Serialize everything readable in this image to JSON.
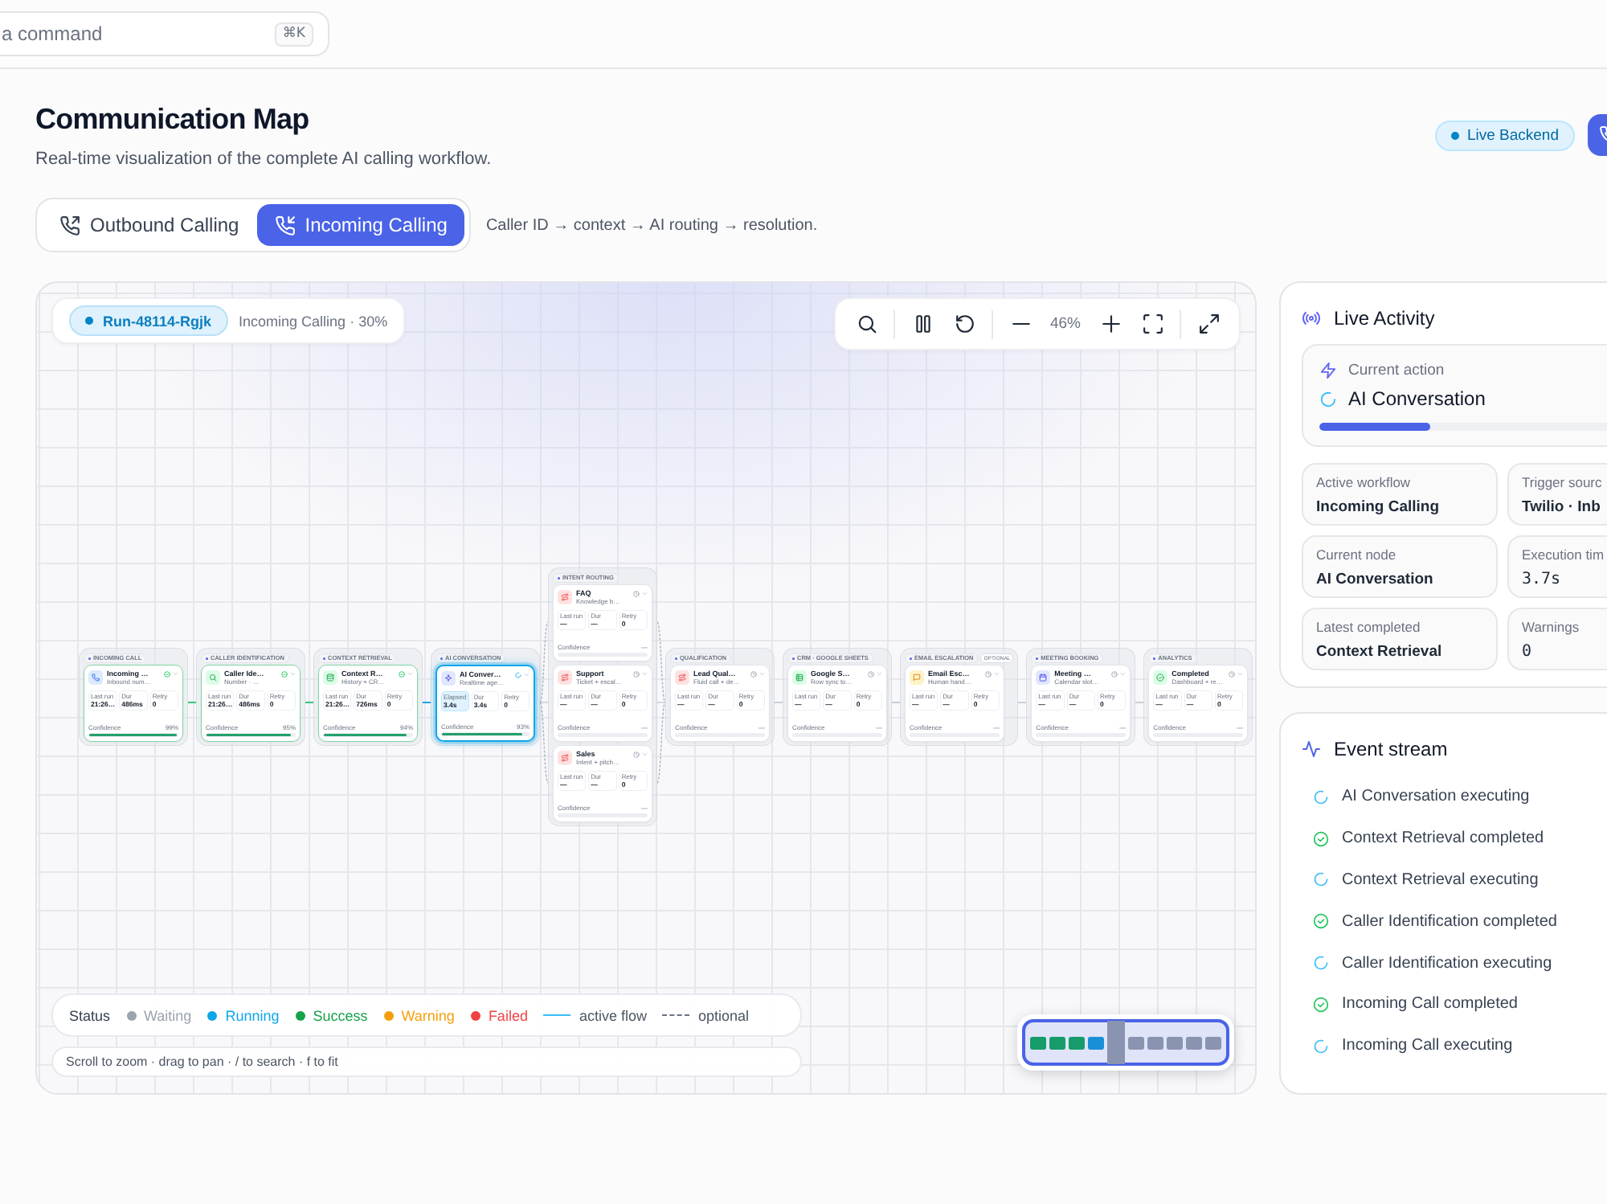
{
  "command_search": {
    "placeholder": "a command",
    "shortcut": "⌘K"
  },
  "header": {
    "title": "Communication Map",
    "subtitle": "Real-time visualization of the complete AI calling workflow.",
    "status": "Live Backend"
  },
  "tabs": [
    {
      "label": "Outbound Calling",
      "kind": "outgoing",
      "selected": false
    },
    {
      "label": "Incoming Calling",
      "kind": "incoming",
      "selected": true
    }
  ],
  "flow_description": "Caller ID → context → AI routing → resolution.",
  "canvas": {
    "run": {
      "id": "Run-48114-Rgjk",
      "summary": "Incoming Calling · 30%"
    },
    "zoom": "46%",
    "groups": [
      {
        "label": "INCOMING CALL",
        "nodes": [
          {
            "title": "Incoming …",
            "subtitle": "Inbound num…",
            "kind": "phone",
            "completed": true,
            "running": false,
            "stats": [
              {
                "label": "Last run",
                "value": "21:26…"
              },
              {
                "label": "Dur",
                "value": "486ms"
              },
              {
                "label": "Retry",
                "value": "0"
              }
            ],
            "confidence": {
              "label": "Confidence",
              "value": "99%",
              "level": 0.99
            }
          }
        ]
      },
      {
        "label": "CALLER IDENTIFICATION",
        "nodes": [
          {
            "title": "Caller Ide…",
            "subtitle": "Number · …",
            "kind": "search",
            "completed": true,
            "running": false,
            "stats": [
              {
                "label": "Last run",
                "value": "21:26…"
              },
              {
                "label": "Dur",
                "value": "486ms"
              },
              {
                "label": "Retry",
                "value": "0"
              }
            ],
            "confidence": {
              "label": "Confidence",
              "value": "95%",
              "level": 0.95
            }
          }
        ]
      },
      {
        "label": "CONTEXT RETRIEVAL",
        "nodes": [
          {
            "title": "Context R…",
            "subtitle": "History + CR…",
            "kind": "database",
            "completed": true,
            "running": false,
            "stats": [
              {
                "label": "Last run",
                "value": "21:26…"
              },
              {
                "label": "Dur",
                "value": "726ms"
              },
              {
                "label": "Retry",
                "value": "0"
              }
            ],
            "confidence": {
              "label": "Confidence",
              "value": "94%",
              "level": 0.94
            }
          }
        ]
      },
      {
        "label": "AI CONVERSATION",
        "nodes": [
          {
            "title": "AI Conver…",
            "subtitle": "Realtime age…",
            "kind": "ai",
            "completed": false,
            "running": true,
            "stats": [
              {
                "label": "Elapsed",
                "value": "3.4s"
              },
              {
                "label": "Dur",
                "value": "3.4s"
              },
              {
                "label": "Retry",
                "value": "0"
              }
            ],
            "confidence": {
              "label": "Confidence",
              "value": "93%",
              "level": 0.93
            }
          }
        ]
      },
      {
        "label": "INTENT ROUTING",
        "nodes": [
          {
            "title": "FAQ",
            "subtitle": "Knowledge b…",
            "kind": "route",
            "completed": false,
            "running": false,
            "stats": [
              {
                "label": "Last run",
                "value": "—"
              },
              {
                "label": "Dur",
                "value": "—"
              },
              {
                "label": "Retry",
                "value": "0"
              }
            ],
            "confidence": {
              "label": "Confidence",
              "value": "—"
            }
          },
          {
            "title": "Support",
            "subtitle": "Ticket + escal…",
            "kind": "route",
            "completed": false,
            "running": false,
            "stats": [
              {
                "label": "Last run",
                "value": "—"
              },
              {
                "label": "Dur",
                "value": "—"
              },
              {
                "label": "Retry",
                "value": "0"
              }
            ],
            "confidence": {
              "label": "Confidence",
              "value": "—"
            }
          },
          {
            "title": "Sales",
            "subtitle": "Intent + pitch…",
            "kind": "route",
            "completed": false,
            "running": false,
            "stats": [
              {
                "label": "Last run",
                "value": "—"
              },
              {
                "label": "Dur",
                "value": "—"
              },
              {
                "label": "Retry",
                "value": "0"
              }
            ],
            "confidence": {
              "label": "Confidence",
              "value": "—"
            }
          }
        ]
      },
      {
        "label": "QUALIFICATION",
        "nodes": [
          {
            "title": "Lead Qual…",
            "subtitle": "Fluid call + de…",
            "kind": "route",
            "completed": false,
            "running": false,
            "stats": [
              {
                "label": "Last run",
                "value": "—"
              },
              {
                "label": "Dur",
                "value": "—"
              },
              {
                "label": "Retry",
                "value": "0"
              }
            ],
            "confidence": {
              "label": "Confidence",
              "value": "—"
            }
          }
        ]
      },
      {
        "label": "CRM · GOOGLE SHEETS",
        "nodes": [
          {
            "title": "Google S…",
            "subtitle": "Row sync to…",
            "kind": "sheet",
            "completed": false,
            "running": false,
            "stats": [
              {
                "label": "Last run",
                "value": "—"
              },
              {
                "label": "Dur",
                "value": "—"
              },
              {
                "label": "Retry",
                "value": "0"
              }
            ],
            "confidence": {
              "label": "Confidence",
              "value": "—"
            }
          }
        ]
      },
      {
        "label": "EMAIL ESCALATION",
        "badge": "OPTIONAL",
        "nodes": [
          {
            "title": "Email Esc…",
            "subtitle": "Human hand…",
            "kind": "mail",
            "completed": false,
            "running": false,
            "stats": [
              {
                "label": "Last run",
                "value": "—"
              },
              {
                "label": "Dur",
                "value": "—"
              },
              {
                "label": "Retry",
                "value": "0"
              }
            ],
            "confidence": {
              "label": "Confidence",
              "value": "—"
            }
          }
        ]
      },
      {
        "label": "MEETING BOOKING",
        "nodes": [
          {
            "title": "Meeting …",
            "subtitle": "Calendar slot…",
            "kind": "calendar",
            "completed": false,
            "running": false,
            "stats": [
              {
                "label": "Last run",
                "value": "—"
              },
              {
                "label": "Dur",
                "value": "—"
              },
              {
                "label": "Retry",
                "value": "0"
              }
            ],
            "confidence": {
              "label": "Confidence",
              "value": "—"
            }
          }
        ]
      },
      {
        "label": "ANALYTICS",
        "nodes": [
          {
            "title": "Completed",
            "subtitle": "Dashboard + re…",
            "kind": "done",
            "completed": false,
            "running": false,
            "stats": [
              {
                "label": "Last run",
                "value": "—"
              },
              {
                "label": "Dur",
                "value": "—"
              },
              {
                "label": "Retry",
                "value": "0"
              }
            ],
            "confidence": {
              "label": "Confidence",
              "value": "—"
            }
          }
        ]
      }
    ],
    "legend": {
      "title": "Status",
      "items": [
        {
          "label": "Waiting",
          "color": "#9ca3af"
        },
        {
          "label": "Running",
          "color": "#0ea5e9"
        },
        {
          "label": "Success",
          "color": "#16a34a"
        },
        {
          "label": "Warning",
          "color": "#f59e0b"
        },
        {
          "label": "Failed",
          "color": "#ef4444"
        }
      ],
      "lines": [
        {
          "label": "active flow",
          "kind": "solid"
        },
        {
          "label": "optional",
          "kind": "dashed"
        }
      ]
    },
    "hint": "Scroll to zoom · drag to pan · / to search · f to fit"
  },
  "live_activity": {
    "title": "Live Activity",
    "current_action": {
      "label": "Current action",
      "value": "AI Conversation",
      "level": 0.3
    },
    "stats": [
      {
        "label": "Active workflow",
        "value": "Incoming Calling",
        "kind": "text"
      },
      {
        "label": "Trigger sourc",
        "value": "Twilio · Inb",
        "kind": "text"
      },
      {
        "label": "Current node",
        "value": "AI Conversation",
        "kind": "text"
      },
      {
        "label": "Execution tim",
        "value": "3.7s",
        "kind": "code"
      },
      {
        "label": "Latest completed",
        "value": "Context Retrieval",
        "kind": "text"
      },
      {
        "label": "Warnings",
        "value": "0",
        "kind": "code"
      }
    ]
  },
  "event_stream": {
    "title": "Event stream",
    "items": [
      {
        "text": "AI Conversation executing",
        "kind": "executing"
      },
      {
        "text": "Context Retrieval completed",
        "kind": "completed"
      },
      {
        "text": "Context Retrieval executing",
        "kind": "executing"
      },
      {
        "text": "Caller Identification completed",
        "kind": "completed"
      },
      {
        "text": "Caller Identification executing",
        "kind": "executing"
      },
      {
        "text": "Incoming Call completed",
        "kind": "completed"
      },
      {
        "text": "Incoming Call executing",
        "kind": "executing"
      }
    ]
  }
}
